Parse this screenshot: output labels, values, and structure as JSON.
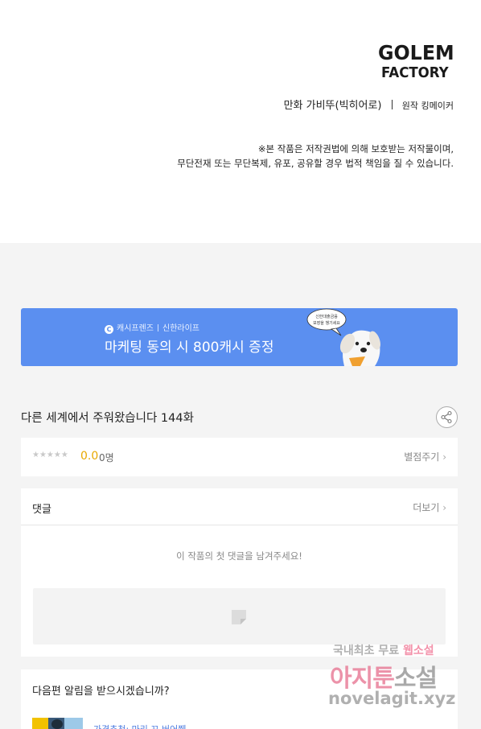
{
  "header": {
    "logo": {
      "line1": "GOLEM",
      "line2": "FACTORY"
    },
    "credits": {
      "art_label": "만화",
      "art_name": "가비뚜(빅히어로)",
      "original": "원작 킹메이커"
    },
    "notice": [
      "※본 작품은 저작권법에 의해 보호받는 저작물이며,",
      "무단전재 또는 무단복제, 유포, 공유할 경우 법적 책임을 질 수 있습니다."
    ]
  },
  "banner": {
    "brand": "캐시프렌즈",
    "partner": "신한라이프",
    "title": "마케팅 동의 시 800캐시 증정",
    "bubble": [
      "신한대출금융",
      "보장을 챙기세요"
    ],
    "bg_color": "#5b8ff0"
  },
  "episode": {
    "title": "다른 세계에서 주워왔습니다 144화",
    "share_icon": "share-icon"
  },
  "rating": {
    "stars": "★★★★★",
    "score": "0.0",
    "count": "0명",
    "rate_link": "별점주기"
  },
  "comments": {
    "heading": "댓글",
    "more": "더보기",
    "empty_text": "이 작품의 첫 댓글을 남겨주세요!"
  },
  "notify": {
    "question": "다음편 알림을 받으시겠습니까?",
    "next_title": "가격추천: 마리 꼬 버어쮀"
  },
  "watermark": {
    "line1a": "국내최초 무료",
    "line1b": "웹소설",
    "line2a": "아지툰",
    "line2b": "소설",
    "line3": "novelagit.xyz"
  }
}
